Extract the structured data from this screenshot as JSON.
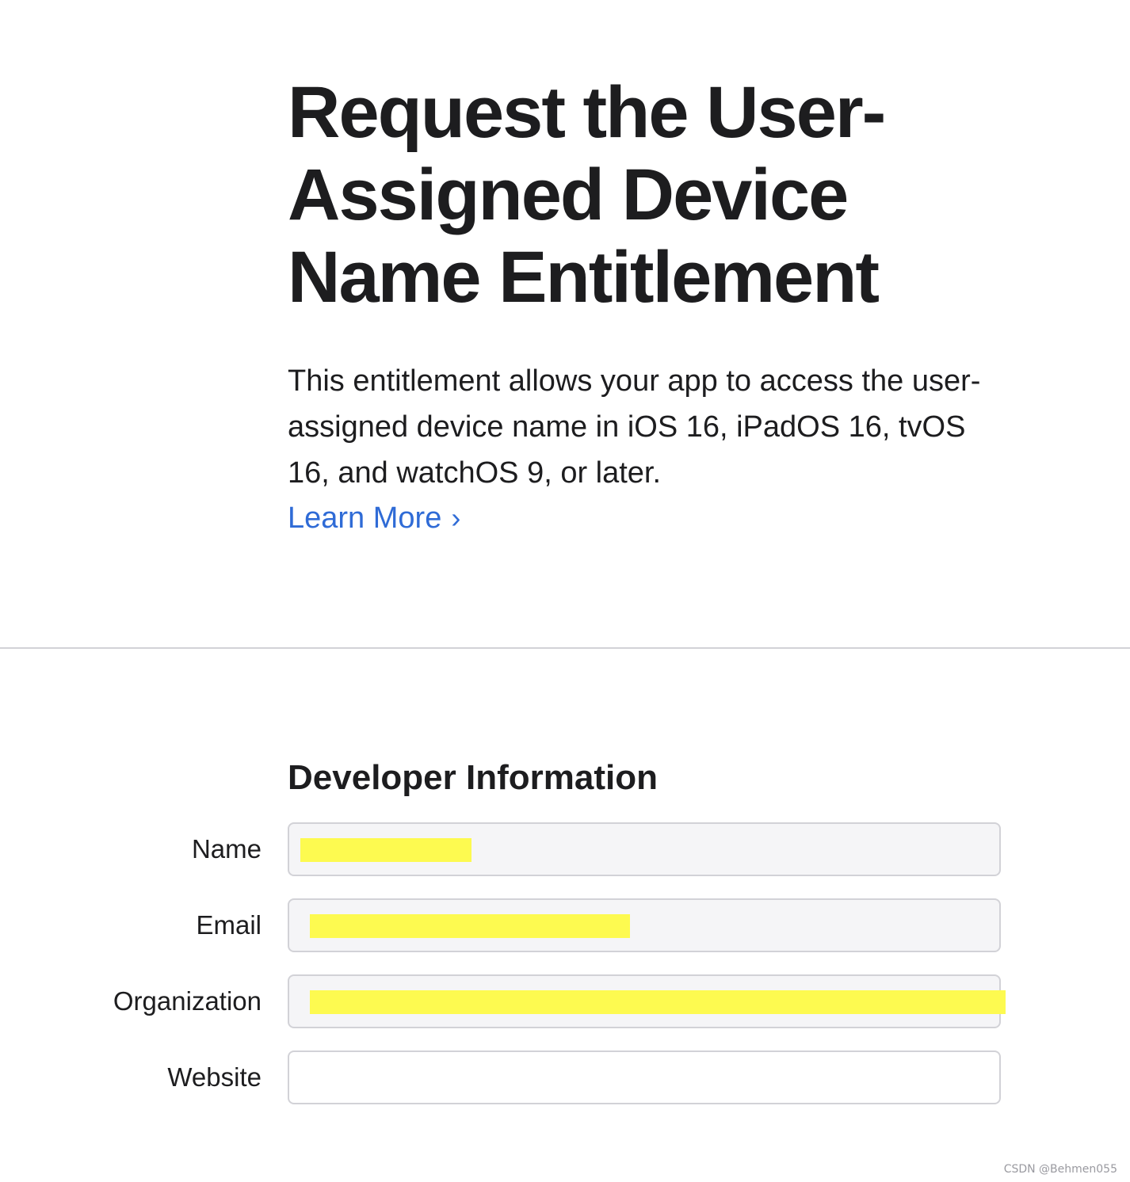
{
  "hero": {
    "title": "Request the User-\nAssigned Device\nName Entitlement",
    "description": "This entitlement allows your app to access the user-assigned device name in iOS 16, iPadOS 16, tvOS 16, and watchOS 9, or later.",
    "learn_more_label": "Learn More",
    "learn_more_chevron": "›"
  },
  "section": {
    "heading": "Developer Information"
  },
  "form": {
    "name": {
      "label": "Name",
      "value": "",
      "state": "read-only, redacted"
    },
    "email": {
      "label": "Email",
      "value": "",
      "state": "read-only, redacted"
    },
    "organization": {
      "label": "Organization",
      "value": "",
      "state": "read-only, redacted"
    },
    "website": {
      "label": "Website",
      "value": "",
      "placeholder": ""
    }
  },
  "colors": {
    "link": "#2f6bd6",
    "text": "#1d1d1f",
    "field_border": "#d2d2d7",
    "field_readonly_bg": "#f5f5f7",
    "redaction": "#fdfa50"
  },
  "watermark": "CSDN @Behmen055"
}
